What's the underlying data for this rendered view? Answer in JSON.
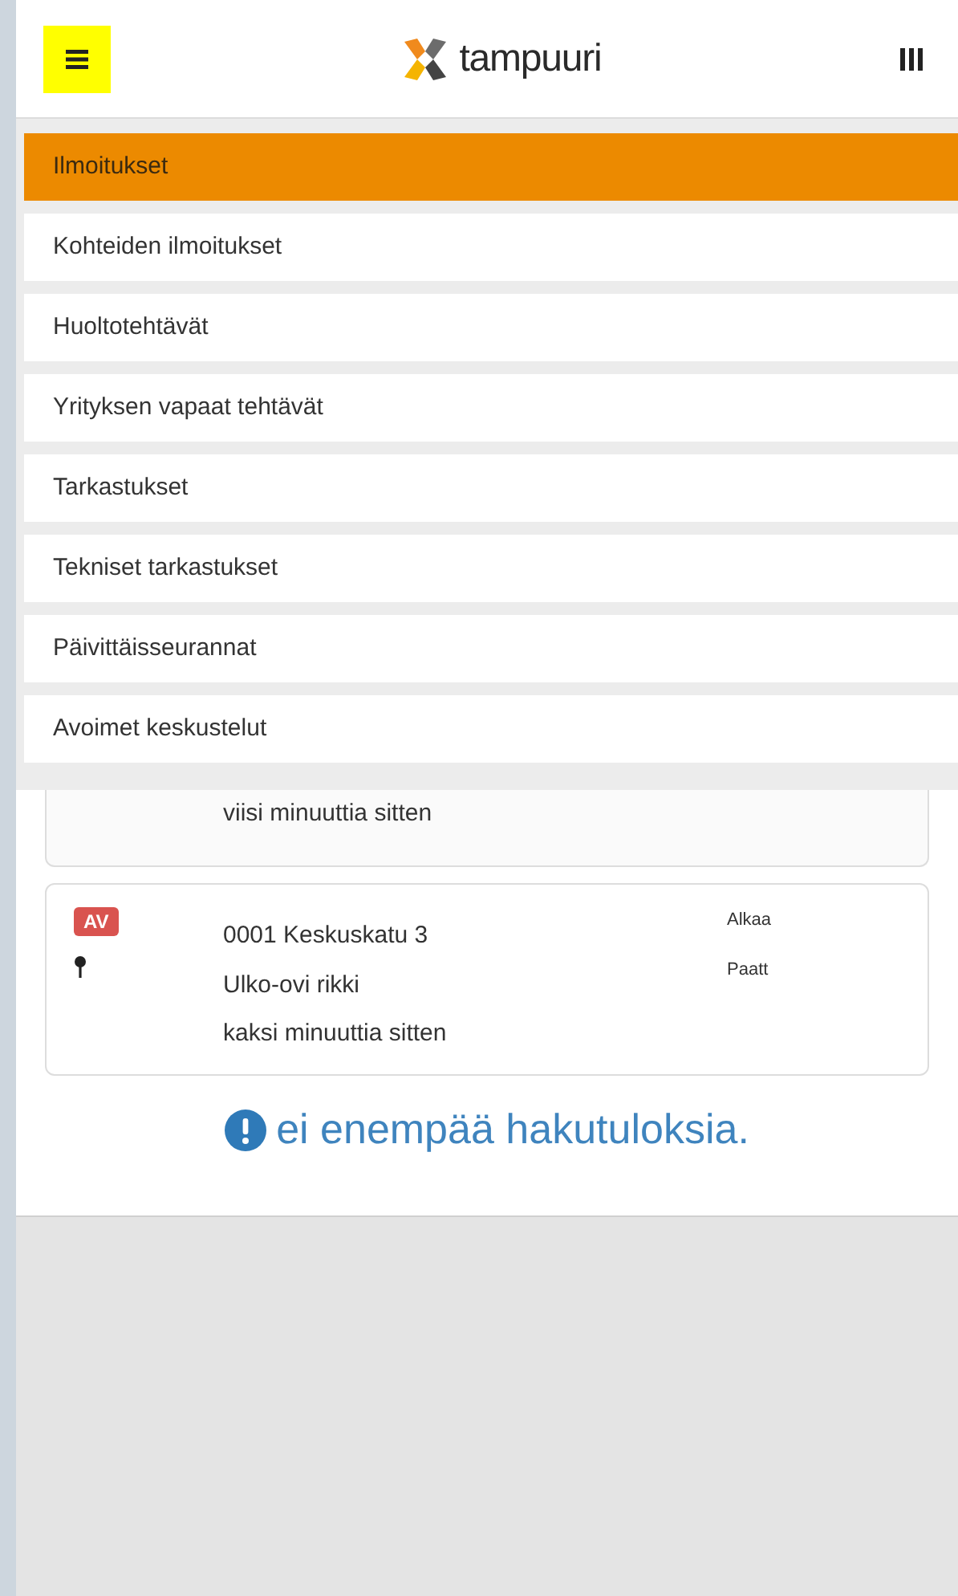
{
  "header": {
    "logo": "tampuuri"
  },
  "menu": {
    "items": [
      {
        "label": "Ilmoitukset",
        "selected": true
      },
      {
        "label": "Kohteiden ilmoitukset",
        "selected": false
      },
      {
        "label": "Huoltotehtävät",
        "selected": false
      },
      {
        "label": "Yrityksen vapaat tehtävät",
        "selected": false
      },
      {
        "label": "Tarkastukset",
        "selected": false
      },
      {
        "label": "Tekniset tarkastukset",
        "selected": false
      },
      {
        "label": "Päivittäisseurannat",
        "selected": false
      },
      {
        "label": "Avoimet keskustelut",
        "selected": false
      }
    ]
  },
  "partial_card": {
    "time": "viisi minuuttia sitten"
  },
  "cards": [
    {
      "badge": "AV",
      "address": "0001 Keskuskatu 3",
      "title": "Ulko-ovi rikki",
      "time": "kaksi minuuttia sitten",
      "start_label": "Alkaa",
      "end_label": "Paatt"
    }
  ],
  "message": "ei enempää hakutuloksia."
}
